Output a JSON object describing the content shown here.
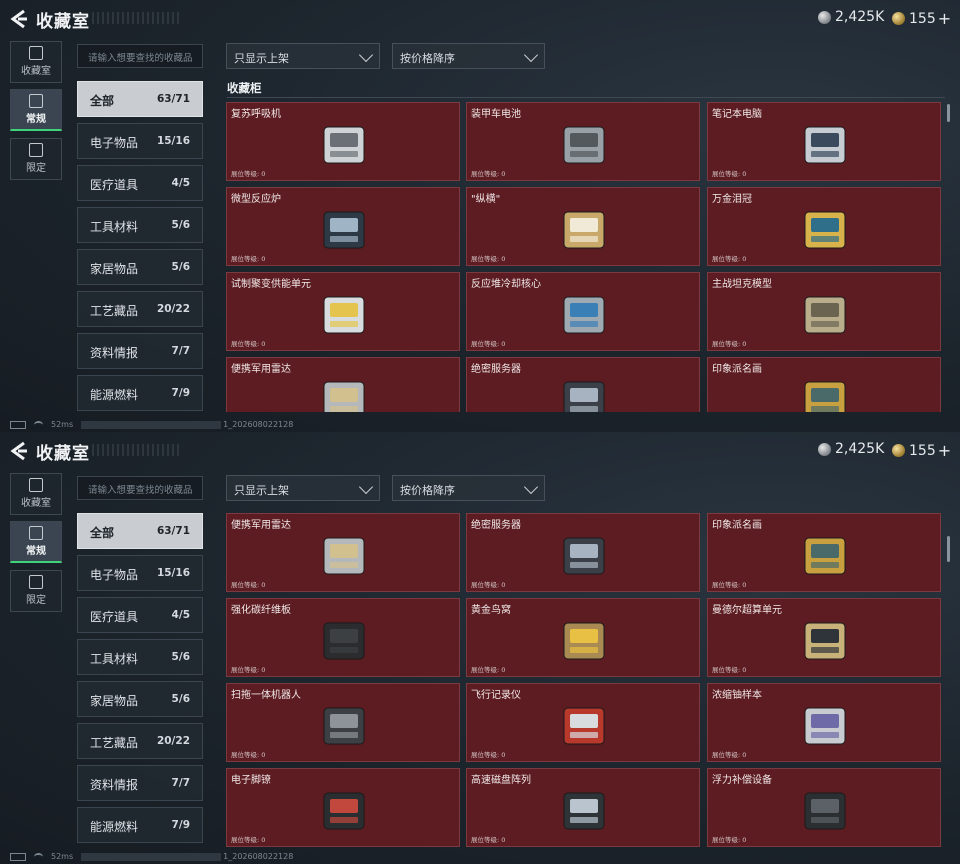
{
  "app": {
    "title": "收藏室"
  },
  "currency": {
    "silver": "2,425K",
    "gold": "155",
    "gold_plus": "+"
  },
  "side_tabs": [
    {
      "label": "收藏室",
      "icon": "portrait-icon"
    },
    {
      "label": "常规",
      "icon": "frame-icon"
    },
    {
      "label": "限定",
      "icon": "picture-icon"
    }
  ],
  "search": {
    "placeholder": "请输入想要查找的收藏品"
  },
  "filters": {
    "display": "只显示上架",
    "sort": "按价格降序"
  },
  "categories": [
    {
      "label": "全部",
      "count": "63/71"
    },
    {
      "label": "电子物品",
      "count": "15/16"
    },
    {
      "label": "医疗道具",
      "count": "4/5"
    },
    {
      "label": "工具材料",
      "count": "5/6"
    },
    {
      "label": "家居物品",
      "count": "5/6"
    },
    {
      "label": "工艺藏品",
      "count": "20/22"
    },
    {
      "label": "资料情报",
      "count": "7/7"
    },
    {
      "label": "能源燃料",
      "count": "7/9"
    }
  ],
  "section_title": "收藏柜",
  "level_label": "展位等级: 0",
  "items": [
    {
      "name": "复苏呼吸机",
      "icon": "ventilator-icon"
    },
    {
      "name": "装甲车电池",
      "icon": "battery-icon"
    },
    {
      "name": "笔记本电脑",
      "icon": "laptop-icon"
    },
    {
      "name": "微型反应炉",
      "icon": "reactor-icon"
    },
    {
      "name": "\"纵横\"",
      "icon": "chessboard-icon"
    },
    {
      "name": "万金泪冠",
      "icon": "crown-egg-icon"
    },
    {
      "name": "试制聚变供能单元",
      "icon": "fusion-cell-icon"
    },
    {
      "name": "反应堆冷却核心",
      "icon": "cooling-core-icon"
    },
    {
      "name": "主战坦克模型",
      "icon": "tank-icon"
    },
    {
      "name": "便携军用雷达",
      "icon": "radar-icon"
    },
    {
      "name": "绝密服务器",
      "icon": "server-icon"
    },
    {
      "name": "印象派名画",
      "icon": "painting-icon"
    },
    {
      "name": "强化碳纤维板",
      "icon": "carbon-plate-icon"
    },
    {
      "name": "黄金鸟窝",
      "icon": "golden-nest-icon"
    },
    {
      "name": "曼德尔超算单元",
      "icon": "supercomputer-icon"
    },
    {
      "name": "扫拖一体机器人",
      "icon": "robot-vacuum-icon"
    },
    {
      "name": "飞行记录仪",
      "icon": "flight-recorder-icon"
    },
    {
      "name": "浓缩铀样本",
      "icon": "uranium-icon"
    },
    {
      "name": "电子脚镣",
      "icon": "ankle-monitor-icon"
    },
    {
      "name": "高速磁盘阵列",
      "icon": "disk-array-icon"
    },
    {
      "name": "浮力补偿设备",
      "icon": "buoyancy-icon"
    }
  ],
  "status": {
    "ping": "52ms",
    "build": "1_202608022128"
  },
  "colors": {
    "card_bg": "#5c1c22",
    "accent_green": "#3fd47a",
    "active_category": "#c9cdd1"
  }
}
